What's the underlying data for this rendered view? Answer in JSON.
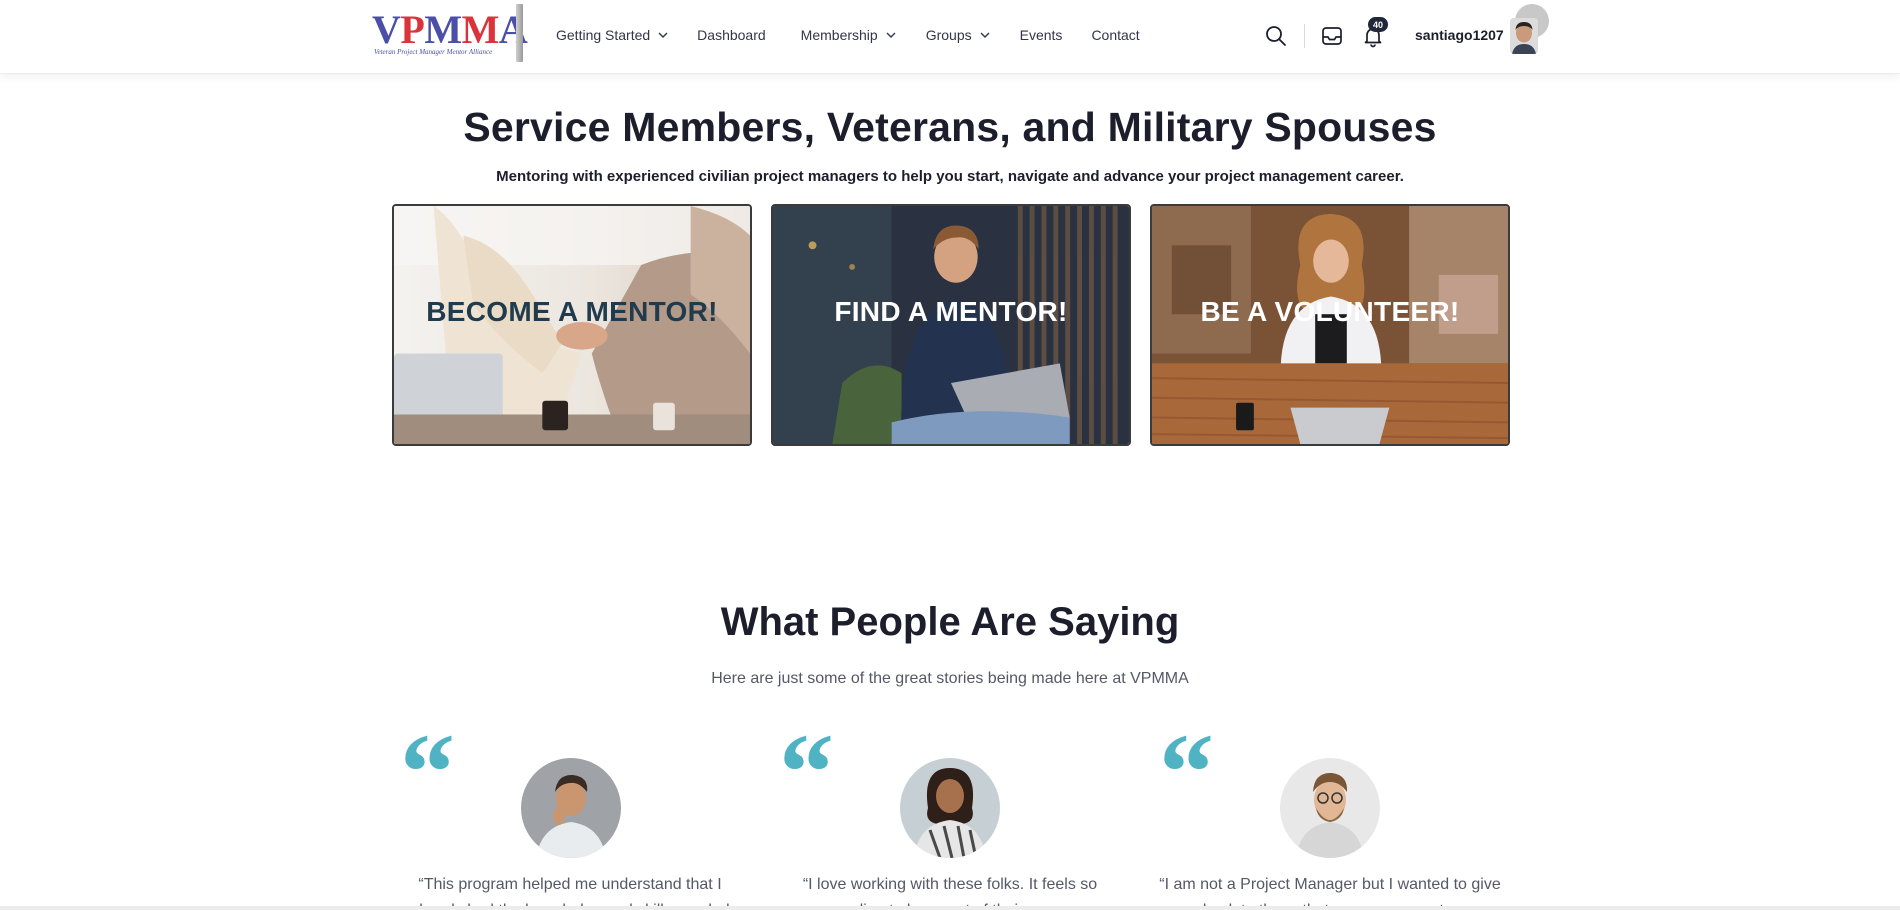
{
  "header": {
    "logo": {
      "word": "VPMMA",
      "tagline": "Veteran Project Manager Mentor Alliance"
    },
    "nav": [
      {
        "label": "Getting Started",
        "dropdown": true
      },
      {
        "label": "Dashboard",
        "dropdown": false
      },
      {
        "label": "Membership",
        "dropdown": true
      },
      {
        "label": "Groups",
        "dropdown": true
      },
      {
        "label": "Events",
        "dropdown": false
      },
      {
        "label": "Contact",
        "dropdown": false
      }
    ],
    "icons": [
      "search-icon",
      "inbox-icon",
      "bell-icon"
    ],
    "notification_count": "40",
    "username": "santiago1207"
  },
  "hero": {
    "title": "Service Members, Veterans, and Military Spouses",
    "subtitle": "Mentoring with experienced civilian project managers to help you start, navigate and advance your project management career.",
    "cards": [
      {
        "label": "BECOME A MENTOR!",
        "label_color": "#1f3b4d"
      },
      {
        "label": "FIND A MENTOR!",
        "label_color": "#ffffff"
      },
      {
        "label": "BE A VOLUNTEER!",
        "label_color": "#ffffff"
      }
    ]
  },
  "testimonials": {
    "title": "What People Are Saying",
    "subtitle": "Here are just some of the great stories being made here at VPMMA",
    "quote_glyph": "“",
    "items": [
      {
        "text": "“This program helped me understand that I already had the knowledge and skills needed"
      },
      {
        "text": "“I love working with these folks. It feels so rewarding to be a part of their success"
      },
      {
        "text": "“I am not a Project Manager but I wanted to give back to those that serve our country"
      }
    ]
  },
  "colors": {
    "accent_teal": "#4fb3c3",
    "logo_blue": "#4b4fa8",
    "logo_red": "#d9343c",
    "heading": "#1c1e2c",
    "badge": "#1f2738"
  }
}
